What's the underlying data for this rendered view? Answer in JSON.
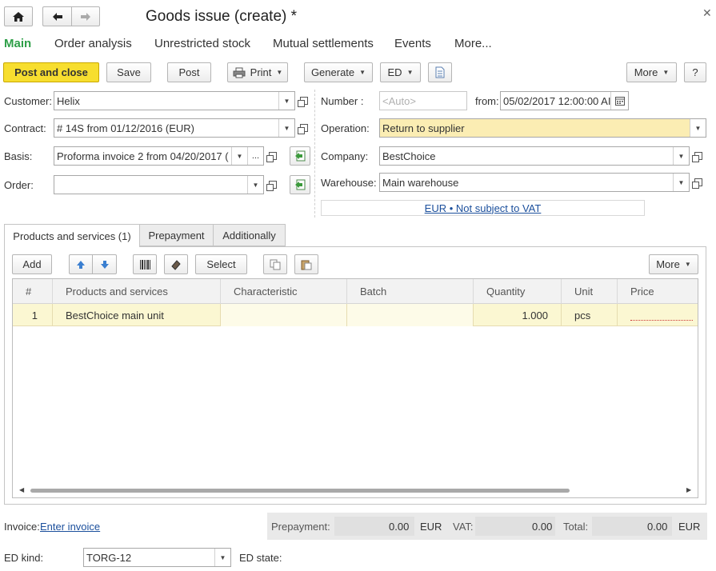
{
  "window": {
    "title": "Goods issue (create) *"
  },
  "nav_tabs": [
    "Main",
    "Order analysis",
    "Unrestricted stock",
    "Mutual settlements",
    "Events",
    "More..."
  ],
  "toolbar": {
    "post_close": "Post and close",
    "save": "Save",
    "post": "Post",
    "print": "Print",
    "generate": "Generate",
    "ed": "ED",
    "more": "More",
    "help": "?"
  },
  "form": {
    "customer_label": "Customer:",
    "customer_value": "Helix",
    "contract_label": "Contract:",
    "contract_value": "# 14S from 01/12/2016 (EUR)",
    "basis_label": "Basis:",
    "basis_value": "Proforma invoice 2 from 04/20/2017 (",
    "order_label": "Order:",
    "order_value": "",
    "number_label": "Number :",
    "number_placeholder": "<Auto>",
    "from_label": "from:",
    "date_value": "05/02/2017 12:00:00 AI",
    "operation_label": "Operation:",
    "operation_value": "Return to supplier",
    "company_label": "Company:",
    "company_value": "BestChoice",
    "warehouse_label": "Warehouse:",
    "warehouse_value": "Main warehouse",
    "currency_link": "EUR • Not subject to VAT"
  },
  "sections": {
    "tabs": [
      "Products and services (1)",
      "Prepayment",
      "Additionally"
    ]
  },
  "table_toolbar": {
    "add": "Add",
    "select": "Select",
    "more": "More"
  },
  "table": {
    "columns": [
      "#",
      "Products and services",
      "Characteristic",
      "Batch",
      "Quantity",
      "Unit",
      "Price"
    ],
    "rows": [
      {
        "num": "1",
        "product": "BestChoice main unit",
        "characteristic": "",
        "batch": "",
        "quantity": "1.000",
        "unit": "pcs",
        "price": ""
      }
    ]
  },
  "footer": {
    "invoice_label": "Invoice:",
    "invoice_link": "Enter invoice",
    "prepayment_label": "Prepayment:",
    "prepayment_value": "0.00",
    "prepayment_currency": "EUR",
    "vat_label": "VAT:",
    "vat_value": "0.00",
    "total_label": "Total:",
    "total_value": "0.00",
    "total_currency": "EUR",
    "ed_kind_label": "ED kind:",
    "ed_kind_value": "TORG-12",
    "ed_state_label": "ED state:"
  },
  "colors": {
    "accent_green": "#2e9f48",
    "post_button": "#f7de2f",
    "operation_bg": "#fbedb3",
    "selected_row": "#fbf7d2",
    "link": "#1b4f9c",
    "totals_bg": "#e9e9e9"
  },
  "icons": {
    "home": "home-icon",
    "back": "arrow-left-icon",
    "forward": "arrow-right-icon",
    "close": "close-icon",
    "print": "printer-icon",
    "report": "document-icon",
    "calendar": "calendar-icon",
    "fill": "fill-icon",
    "up": "arrow-up-icon",
    "down": "arrow-down-icon",
    "barcode": "barcode-icon",
    "eraser": "eraser-icon",
    "copy": "copy-icon",
    "paste": "paste-icon"
  }
}
